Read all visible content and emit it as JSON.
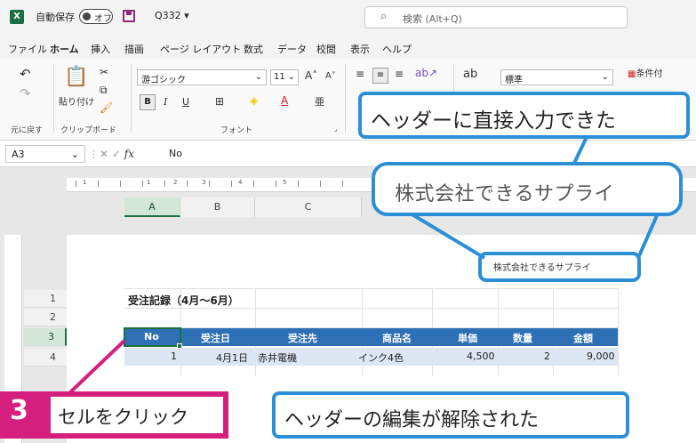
{
  "titlebar": {
    "app_icon": "X",
    "autosave_label": "自動保存",
    "autosave_state": "オフ",
    "filename": "Q332 ▾",
    "search_placeholder": "検索 (Alt+Q)"
  },
  "menu": {
    "items": [
      "ファイル",
      "ホーム",
      "挿入",
      "描画",
      "ページ レイアウト",
      "数式",
      "データ",
      "校閲",
      "表示",
      "ヘルプ"
    ],
    "active": "ホーム"
  },
  "ribbon": {
    "undo_label": "元に戻す",
    "paste_label": "貼り付け",
    "clipboard_label": "クリップボード",
    "font_name": "游ゴシック",
    "font_size": "11",
    "bold": "B",
    "italic": "I",
    "underline": "U",
    "font_group_label": "フォント",
    "number_format": "標準",
    "conditional_format": "条件付"
  },
  "formula_bar": {
    "name_box": "A3",
    "fx": "fx",
    "content": "No"
  },
  "sheet": {
    "columns": [
      "A",
      "B",
      "C"
    ],
    "rows": [
      "1",
      "2",
      "3",
      "4"
    ],
    "selected_col": "A",
    "selected_row": "3",
    "header_text_small": "株式会社できるサプライ",
    "title": "受注記録（4月～6月）",
    "table_headers": [
      "No",
      "受注日",
      "受注先",
      "商品名",
      "単価",
      "数量",
      "金額"
    ],
    "row1": [
      "1",
      "4月1日",
      "赤井電機",
      "インク4色",
      "4,500",
      "2",
      "9,000"
    ]
  },
  "callouts": {
    "top": "ヘッダーに直接入力できた",
    "zoom": "株式会社できるサプライ",
    "bottom": "ヘッダーの編集が解除された",
    "step_number": "3",
    "step_text": "セルをクリック"
  },
  "colors": {
    "excel_green": "#1d6f42",
    "table_header": "#2e70b5",
    "callout_blue": "#2c8fd6",
    "step_pink": "#d51f7e"
  }
}
